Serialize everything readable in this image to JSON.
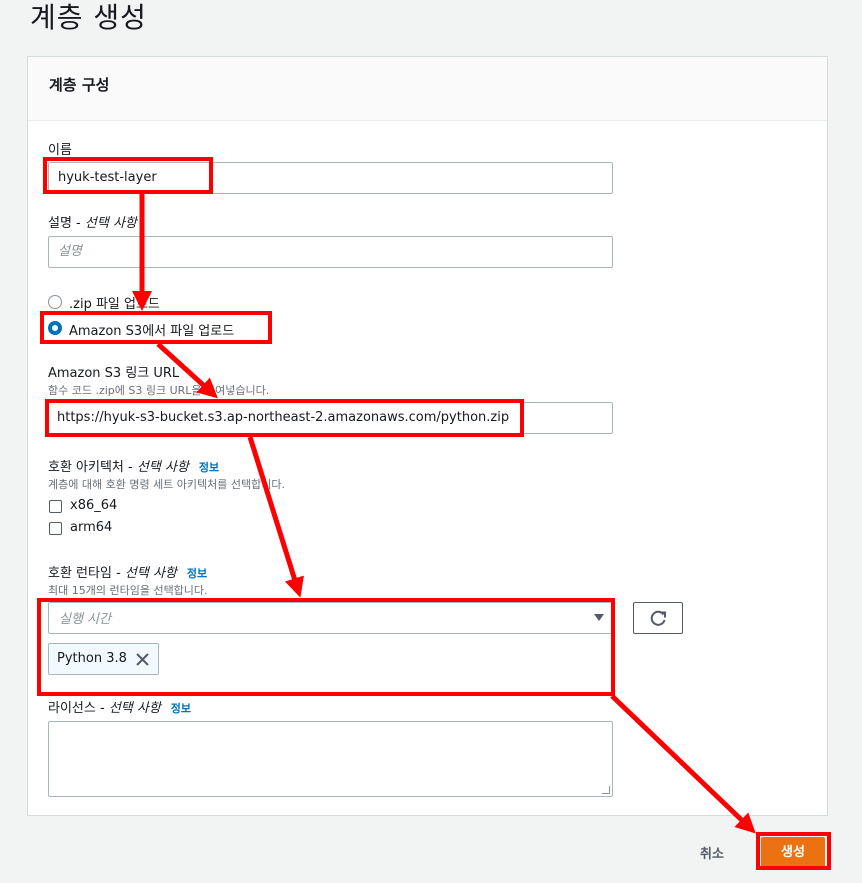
{
  "page": {
    "title": "계층 생성"
  },
  "panel": {
    "title": "계층 구성"
  },
  "name": {
    "label": "이름",
    "value": "hyuk-test-layer"
  },
  "description": {
    "label": "설명",
    "optional": "선택 사항",
    "placeholder": "설명"
  },
  "upload": {
    "options": [
      {
        "label": ".zip 파일 업로드",
        "selected": false
      },
      {
        "label": "Amazon S3에서 파일 업로드",
        "selected": true
      }
    ]
  },
  "s3": {
    "label": "Amazon S3 링크 URL",
    "hint": "함수 코드 .zip에 S3 링크 URL을 붙여넣습니다.",
    "value": "https://hyuk-s3-bucket.s3.ap-northeast-2.amazonaws.com/python.zip"
  },
  "arch": {
    "label": "호환 아키텍처",
    "optional": "선택 사항",
    "info": "정보",
    "hint": "계층에 대해 호환 명령 세트 아키텍처를 선택합니다.",
    "options": [
      {
        "label": "x86_64",
        "checked": false
      },
      {
        "label": "arm64",
        "checked": false
      }
    ]
  },
  "runtime": {
    "label": "호환 런타임",
    "optional": "선택 사항",
    "info": "정보",
    "hint": "최대 15개의 런타임을 선택합니다.",
    "placeholder": "실행 시간",
    "selected_tokens": [
      "Python 3.8"
    ]
  },
  "license": {
    "label": "라이선스",
    "optional": "선택 사항",
    "info": "정보"
  },
  "actions": {
    "cancel": "취소",
    "create": "생성"
  },
  "annotation_color": "#ff0000"
}
